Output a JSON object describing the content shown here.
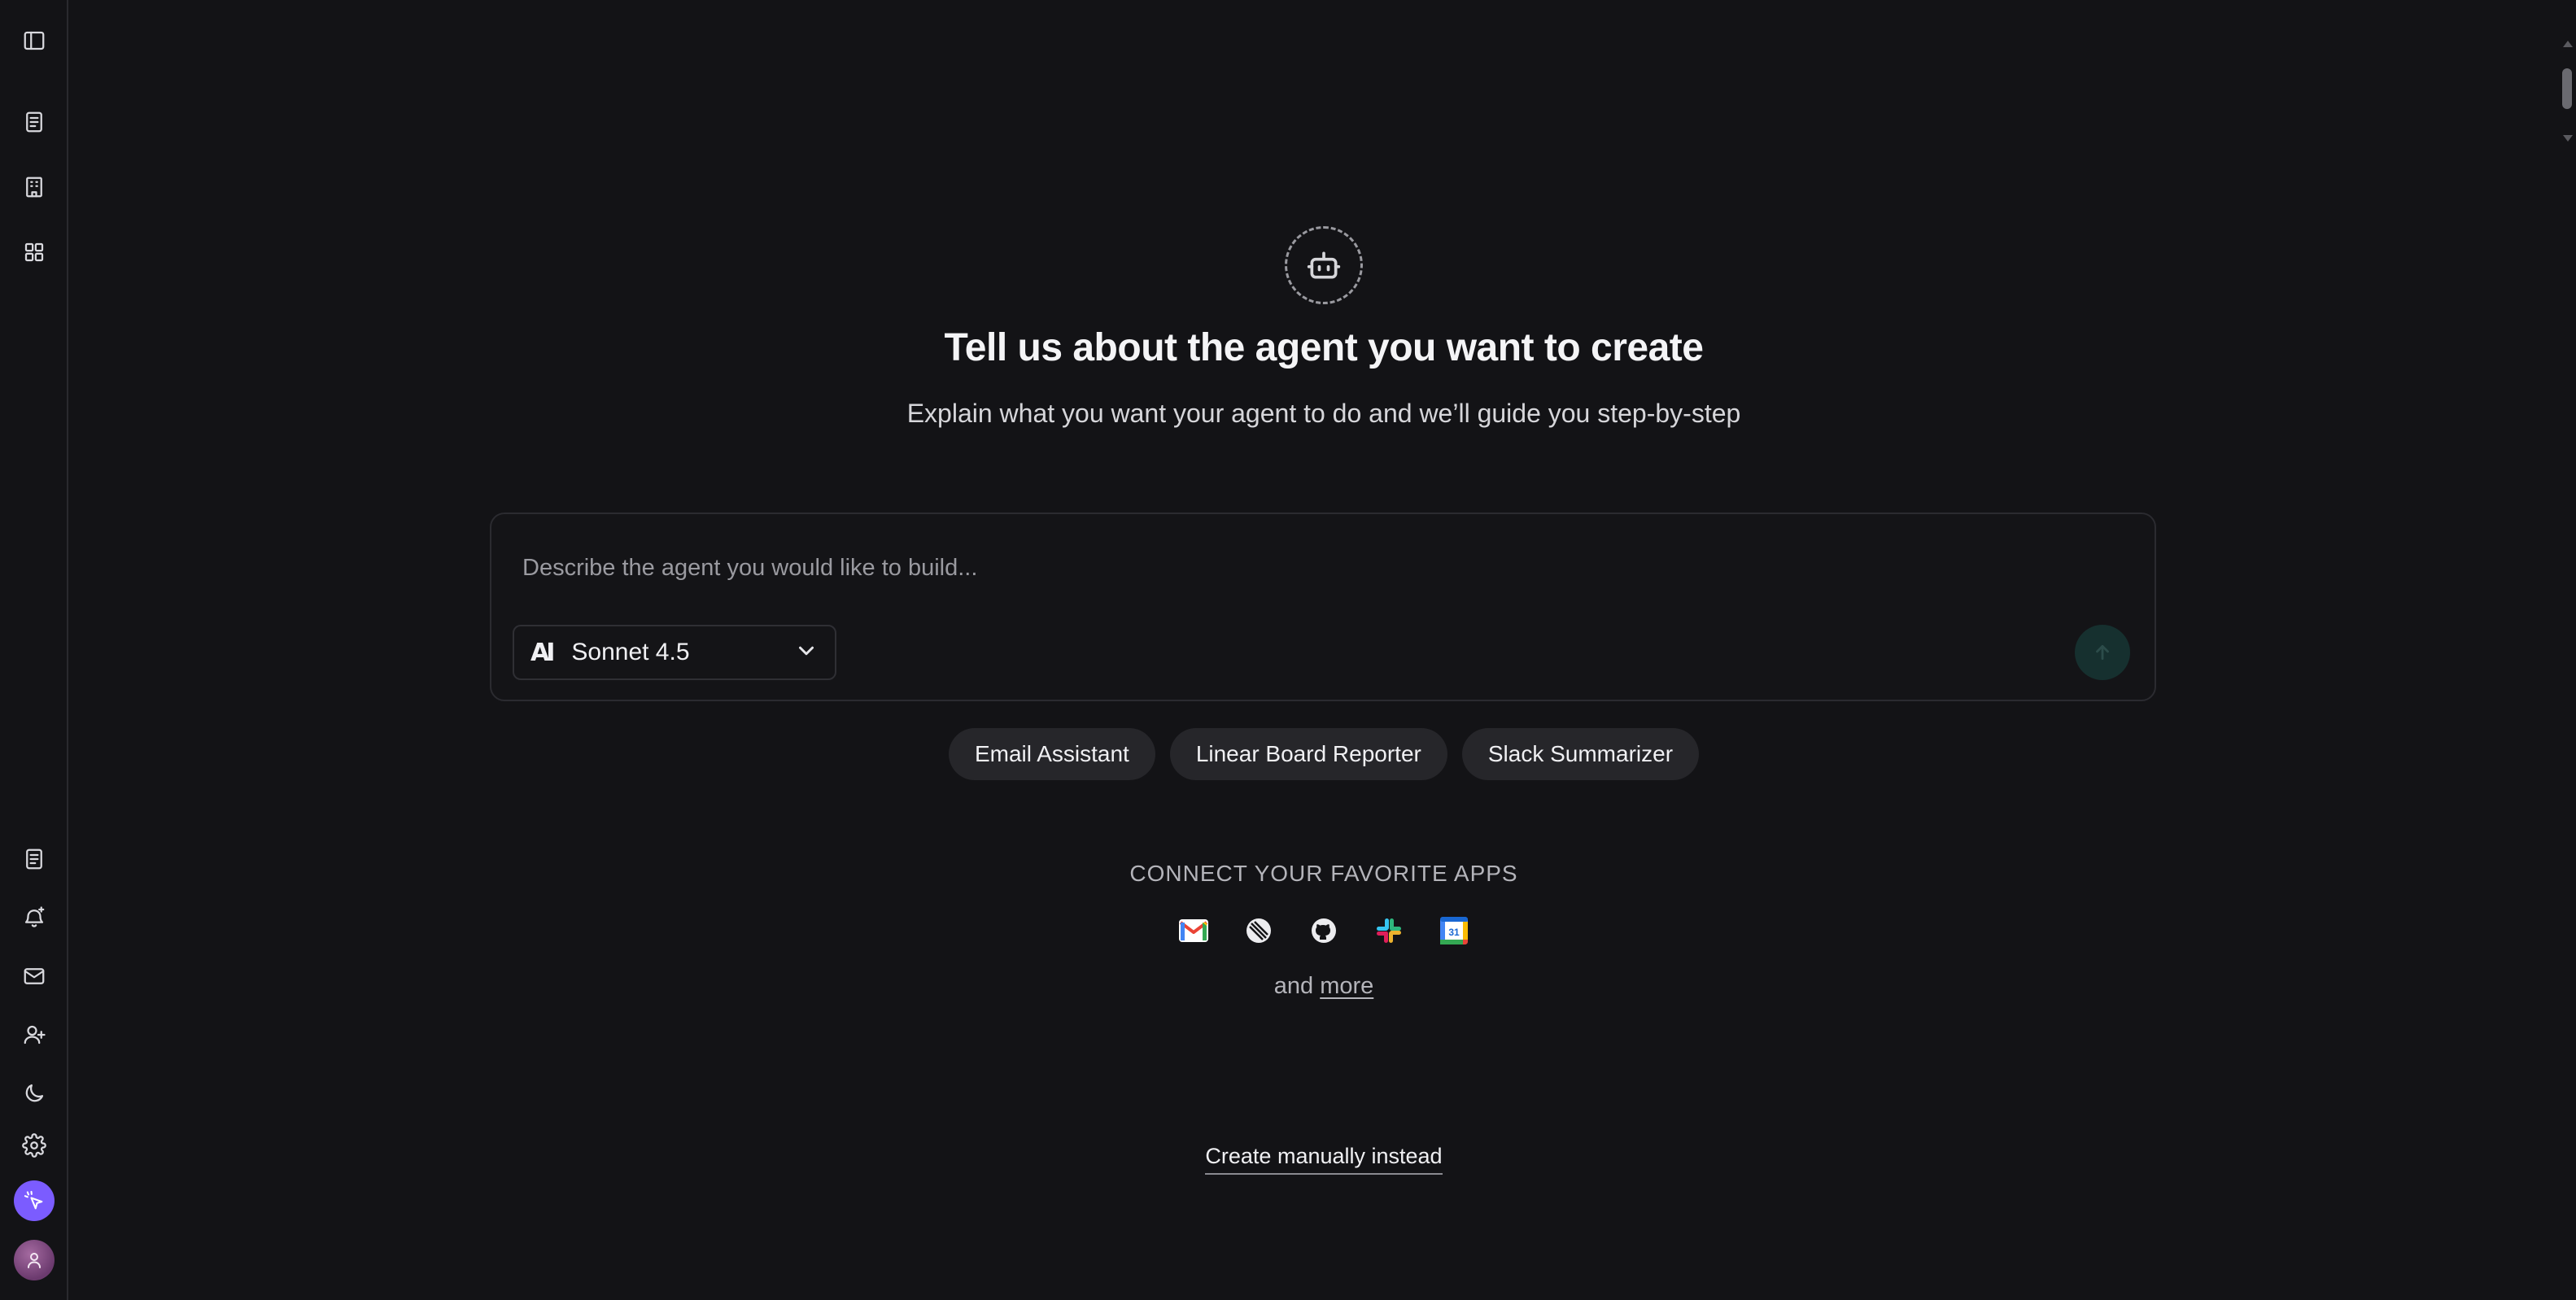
{
  "rail": {
    "top_items": [
      {
        "name": "toggle-sidebar-icon"
      },
      {
        "name": "document-icon"
      },
      {
        "name": "building-icon"
      },
      {
        "name": "grid-icon"
      }
    ],
    "bottom_items": [
      {
        "name": "notes-icon"
      },
      {
        "name": "bell-plus-icon"
      },
      {
        "name": "mail-icon"
      },
      {
        "name": "user-plus-icon"
      },
      {
        "name": "moon-icon"
      },
      {
        "name": "settings-icon"
      }
    ]
  },
  "hero": {
    "icon": "bot-icon",
    "title": "Tell us about the agent you want to create",
    "subtitle": "Explain what you want your agent to do and we’ll guide you step-by-step"
  },
  "composer": {
    "placeholder": "Describe the agent you would like to build...",
    "value": "",
    "model": {
      "logo": "AI",
      "label": "Sonnet 4.5"
    },
    "send_icon": "arrow-up-icon",
    "send_color": "#16302f"
  },
  "suggestions": [
    "Email Assistant",
    "Linear Board Reporter",
    "Slack Summarizer"
  ],
  "connect": {
    "heading": "CONNECT YOUR FAVORITE APPS",
    "apps": [
      "gmail-icon",
      "linear-icon",
      "github-icon",
      "slack-icon",
      "google-calendar-icon"
    ],
    "calendar_day": "31",
    "and_text": "and",
    "more_text": "more"
  },
  "manual_link": "Create manually instead",
  "colors": {
    "background": "#131316",
    "accent_purple": "#7b5cff",
    "chip_bg": "#26262a"
  }
}
